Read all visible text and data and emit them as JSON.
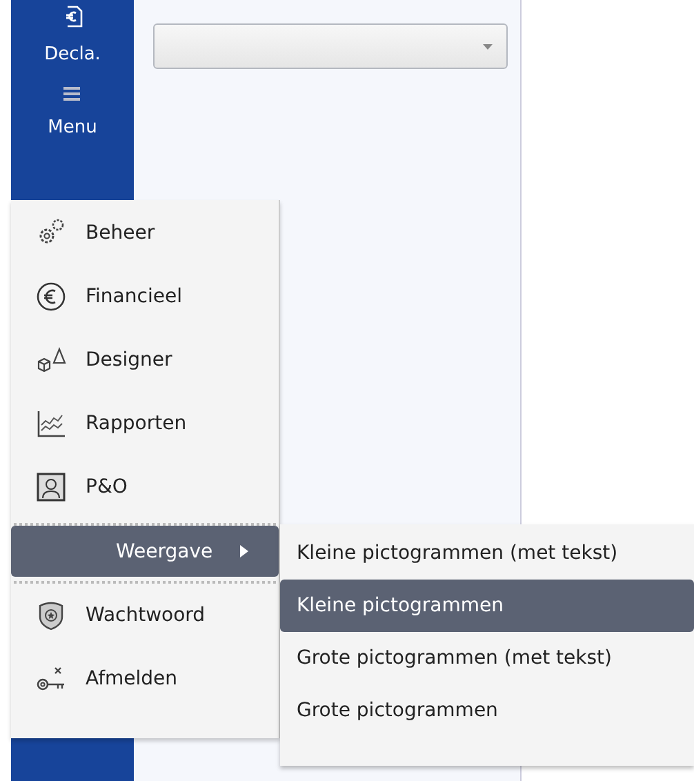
{
  "sidebar": {
    "items": [
      {
        "label": "Decla."
      },
      {
        "label": "Menu"
      }
    ]
  },
  "form": {
    "dropdown": {
      "expanded": false
    }
  },
  "menu": {
    "items": [
      {
        "kind": "item",
        "label": "Beheer",
        "selected": false
      },
      {
        "kind": "item",
        "label": "Financieel",
        "selected": false
      },
      {
        "kind": "item",
        "label": "Designer",
        "selected": false
      },
      {
        "kind": "item",
        "label": "Rapporten",
        "selected": false
      },
      {
        "kind": "item",
        "label": "P&O",
        "selected": false
      },
      {
        "kind": "separator"
      },
      {
        "kind": "submenu",
        "label": "Weergave",
        "selected": true
      },
      {
        "kind": "separator"
      },
      {
        "kind": "item",
        "label": "Wachtwoord",
        "selected": false
      },
      {
        "kind": "item",
        "label": "Afmelden",
        "selected": false
      }
    ]
  },
  "submenu": {
    "items": [
      {
        "label": "Kleine pictogrammen (met tekst)",
        "selected": false
      },
      {
        "label": "Kleine pictogrammen",
        "selected": true
      },
      {
        "label": "Grote pictogrammen (met tekst)",
        "selected": false
      },
      {
        "label": "Grote pictogrammen",
        "selected": false
      }
    ]
  }
}
